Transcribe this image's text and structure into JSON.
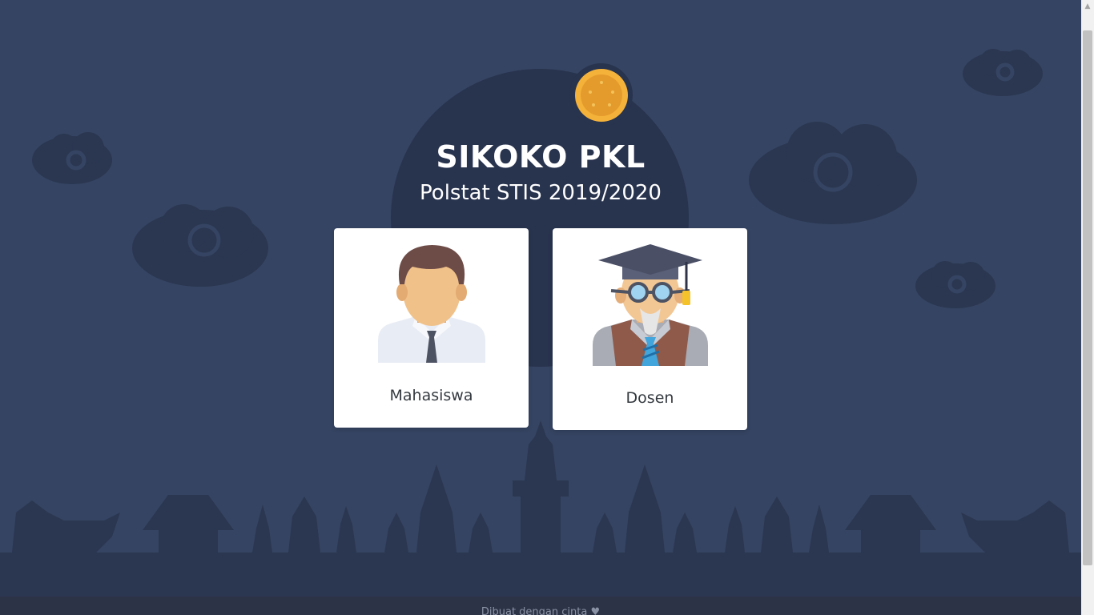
{
  "header": {
    "title": "SIKOKO PKL",
    "subtitle": "Polstat STIS 2019/2020"
  },
  "roles": [
    {
      "label": "Mahasiswa",
      "icon": "student-avatar-icon"
    },
    {
      "label": "Dosen",
      "icon": "lecturer-avatar-icon"
    }
  ],
  "footer": {
    "text": "Dibuat dengan cinta ♥"
  },
  "colors": {
    "background": "#354462",
    "dark_shape": "#28334e",
    "card": "#ffffff",
    "label": "#343a40",
    "logo": "#f4b23a"
  }
}
